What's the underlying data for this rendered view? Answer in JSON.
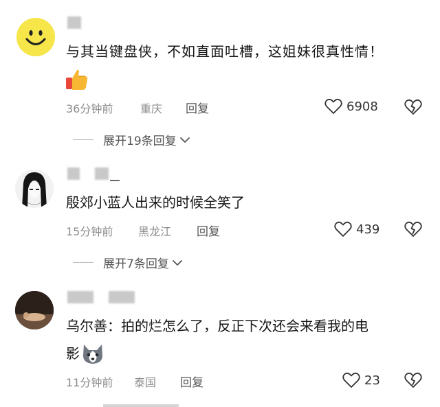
{
  "comments": [
    {
      "content": "与其当键盘侠，不如直面吐槽，这姐妹很真性情！",
      "emoji": "thumbs-up-emoji",
      "time": "36分钟前",
      "location": "重庆",
      "reply_label": "回复",
      "likes": "6908",
      "expand_label": "展开19条回复"
    },
    {
      "content": "殷郊小蓝人出来的时候全笑了",
      "time": "15分钟前",
      "location": "黑龙江",
      "reply_label": "回复",
      "likes": "439",
      "expand_label": "展开7条回复"
    },
    {
      "content_line1": "乌尔善：拍的烂怎么了，反正下次还会来看我的电",
      "content_line2": "影",
      "emoji": "husky-emoji",
      "time": "11分钟前",
      "location": "泰国",
      "reply_label": "回复",
      "likes": "23"
    }
  ],
  "icons": {
    "like": "heart-outline-icon",
    "dislike": "broken-heart-icon",
    "expand": "chevron-down-icon"
  },
  "colors": {
    "text": "#161616",
    "meta": "#8c8c8c",
    "smiley": "#f6e64a"
  }
}
